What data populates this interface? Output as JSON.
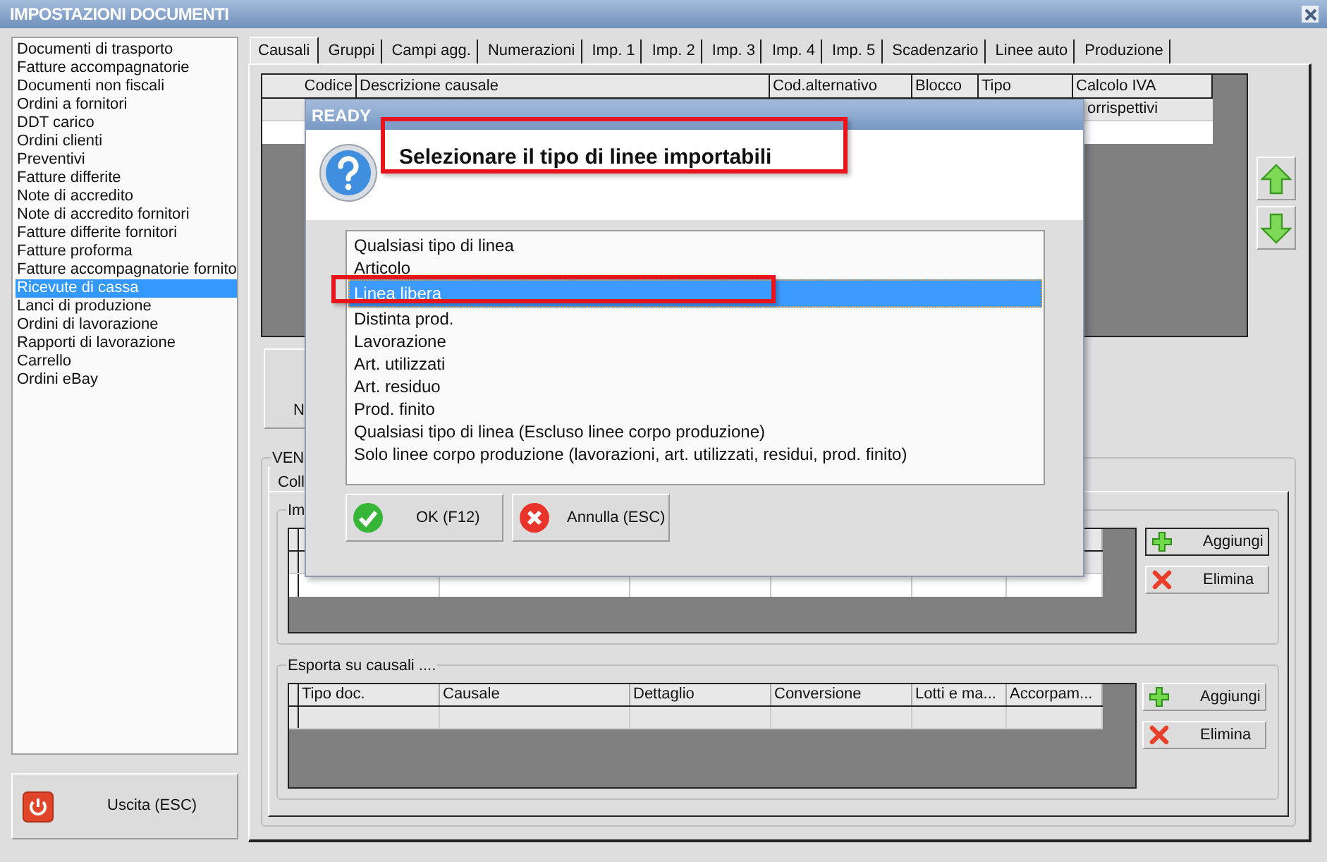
{
  "window": {
    "title": "IMPOSTAZIONI DOCUMENTI"
  },
  "document_types": [
    {
      "label": "Documenti di trasporto",
      "selected": false
    },
    {
      "label": "Fatture accompagnatorie",
      "selected": false
    },
    {
      "label": "Documenti non fiscali",
      "selected": false
    },
    {
      "label": "Ordini a fornitori",
      "selected": false
    },
    {
      "label": "DDT carico",
      "selected": false
    },
    {
      "label": "Ordini clienti",
      "selected": false
    },
    {
      "label": "Preventivi",
      "selected": false
    },
    {
      "label": "Fatture differite",
      "selected": false
    },
    {
      "label": "Note di accredito",
      "selected": false
    },
    {
      "label": "Note di accredito fornitori",
      "selected": false
    },
    {
      "label": "Fatture differite fornitori",
      "selected": false
    },
    {
      "label": "Fatture proforma",
      "selected": false
    },
    {
      "label": "Fatture accompagnatorie fornito",
      "selected": false
    },
    {
      "label": "Ricevute di cassa",
      "selected": true
    },
    {
      "label": "Lanci di produzione",
      "selected": false
    },
    {
      "label": "Ordini di lavorazione",
      "selected": false
    },
    {
      "label": "Rapporti di lavorazione",
      "selected": false
    },
    {
      "label": "Carrello",
      "selected": false
    },
    {
      "label": "Ordini eBay",
      "selected": false
    }
  ],
  "exit_button": {
    "label": "Uscita (ESC)"
  },
  "tabs": [
    {
      "label": "Causali",
      "selected": true
    },
    {
      "label": "Gruppi",
      "selected": false
    },
    {
      "label": "Campi agg.",
      "selected": false
    },
    {
      "label": "Numerazioni",
      "selected": false
    },
    {
      "label": "Imp. 1",
      "selected": false
    },
    {
      "label": "Imp. 2",
      "selected": false
    },
    {
      "label": "Imp. 3",
      "selected": false
    },
    {
      "label": "Imp. 4",
      "selected": false
    },
    {
      "label": "Imp. 5",
      "selected": false
    },
    {
      "label": "Scadenzario",
      "selected": false
    },
    {
      "label": "Linee auto",
      "selected": false
    },
    {
      "label": "Produzione",
      "selected": false
    }
  ],
  "causali_table": {
    "columns": [
      "Codice",
      "Descrizione causale",
      "Cod.alternativo",
      "Blocco",
      "Tipo",
      "Calcolo IVA"
    ],
    "rows": [
      {
        "calcolo_iva": "orrispettivi"
      }
    ]
  },
  "new_button": {
    "label": "N"
  },
  "sales_group": {
    "legend": "VEN",
    "inner_tab": "Coll",
    "import_group": {
      "legend": "Im",
      "buttons": [
        {
          "label": "Aggiungi",
          "kind": "add",
          "focused": true
        },
        {
          "label": "Elimina",
          "kind": "delete",
          "focused": false
        }
      ]
    },
    "export_group": {
      "legend": "Esporta su causali ....",
      "columns": [
        "Tipo doc.",
        "Causale",
        "Dettaglio",
        "Conversione",
        "Lotti e ma...",
        "Accorpam..."
      ],
      "buttons": [
        {
          "label": "Aggiungi",
          "kind": "add",
          "focused": false
        },
        {
          "label": "Elimina",
          "kind": "delete",
          "focused": false
        }
      ]
    }
  },
  "dialog": {
    "title": "READY",
    "heading": "Selezionare il tipo di linee importabili",
    "options": [
      {
        "label": "Qualsiasi tipo di linea",
        "selected": false
      },
      {
        "label": "Articolo",
        "selected": false
      },
      {
        "label": "Linea libera",
        "selected": true
      },
      {
        "label": "Distinta prod.",
        "selected": false
      },
      {
        "label": "Lavorazione",
        "selected": false
      },
      {
        "label": "Art. utilizzati",
        "selected": false
      },
      {
        "label": "Art. residuo",
        "selected": false
      },
      {
        "label": "Prod. finito",
        "selected": false
      },
      {
        "label": "Qualsiasi tipo di linea (Escluso linee corpo produzione)",
        "selected": false
      },
      {
        "label": "Solo linee corpo produzione (lavorazioni, art. utilizzati, residui, prod. finito)",
        "selected": false
      }
    ],
    "buttons": [
      {
        "label": "OK (F12)",
        "kind": "ok"
      },
      {
        "label": "Annulla (ESC)",
        "kind": "cancel"
      }
    ]
  }
}
